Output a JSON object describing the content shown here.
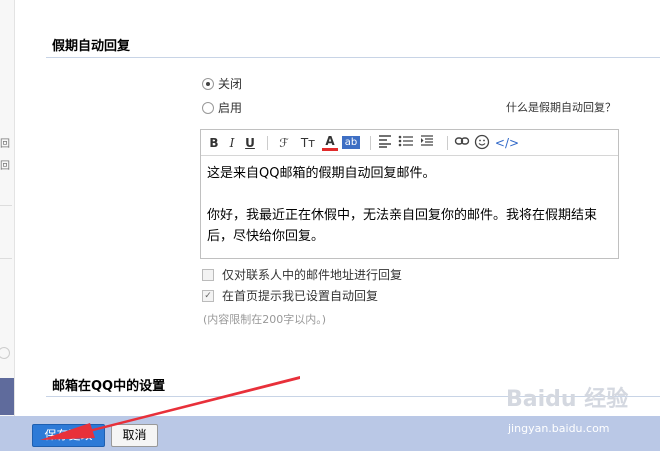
{
  "auto_reply": {
    "title": "假期自动回复",
    "option_off": "关闭",
    "option_on": "启用",
    "help_link": "什么是假期自动回复？",
    "message_line1": "这是来自QQ邮箱的假期自动回复邮件。",
    "message_line2": "你好，我最近正在休假中，无法亲自回复你的邮件。我将在假期结束后，尽快给你回复。",
    "contacts_only": "仅对联系人中的邮件地址进行回复",
    "show_on_home": "在首页提示我已设置自动回复",
    "limit_note": "(内容限制在200字以内。)"
  },
  "toolbar": {
    "bold": "B",
    "italic": "I",
    "underline": "U",
    "font": "ℱ",
    "font_size": "Tт",
    "font_color": "A",
    "background": "ab",
    "code": "</>"
  },
  "qq_settings": {
    "title": "邮箱在QQ中的设置"
  },
  "footer": {
    "save_label": "保存更改",
    "cancel_label": "取消"
  },
  "left_strip": {
    "glyph1": "回",
    "glyph2": "回"
  },
  "watermark": {
    "brand": "Baidu 经验",
    "url": "jingyan.baidu.com"
  },
  "colors": {
    "primary_button": "#2d7ad7",
    "bottom_bar": "#bac8e6",
    "arrow": "#e8303a"
  }
}
